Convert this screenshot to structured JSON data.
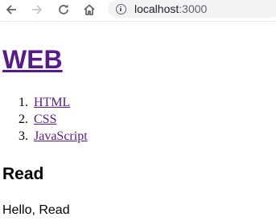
{
  "browser": {
    "url_host": "localhost",
    "url_port": ":3000"
  },
  "page": {
    "title": "WEB",
    "nav": [
      {
        "num": "1.",
        "label": "HTML"
      },
      {
        "num": "2.",
        "label": "CSS"
      },
      {
        "num": "3.",
        "label": "JavaScript"
      }
    ],
    "heading": "Read",
    "body": "Hello, Read"
  }
}
